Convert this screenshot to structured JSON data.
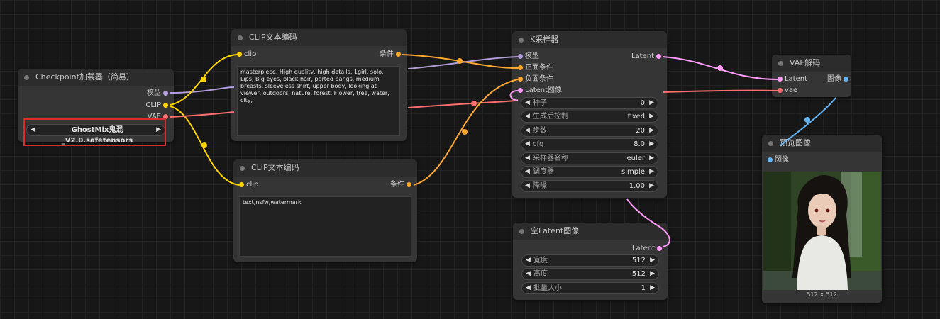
{
  "colors": {
    "model": "#b39ddb",
    "clip": "#ffd500",
    "vae": "#ff6e6e",
    "conditioning": "#ffa931",
    "latent": "#ff9cf9",
    "image": "#64b5f6"
  },
  "checkpoint": {
    "title": "Checkpoint加载器（简易）",
    "out_model": "模型",
    "out_clip": "CLIP",
    "out_vae": "VAE",
    "ckpt_name": "GhostMix鬼混_V2.0.safetensors"
  },
  "clip_pos": {
    "title": "CLIP文本编码",
    "in_clip": "clip",
    "out_cond": "条件",
    "text": "masterpiece, High quality, high details, 1girl, solo, Lips, Big eyes, black hair, parted bangs, medium breasts, sleeveless shirt, upper body, looking at viewer, outdoors, nature, forest, Flower, tree, water, city,"
  },
  "clip_neg": {
    "title": "CLIP文本编码",
    "in_clip": "clip",
    "out_cond": "条件",
    "text": "text,nsfw,watermark"
  },
  "ksampler": {
    "title": "K采样器",
    "in_model": "模型",
    "in_pos": "正面条件",
    "in_neg": "负面条件",
    "in_latent": "Latent图像",
    "out_latent": "Latent",
    "widgets": [
      {
        "label": "种子",
        "value": "0"
      },
      {
        "label": "生成后控制",
        "value": "fixed"
      },
      {
        "label": "步数",
        "value": "20"
      },
      {
        "label": "cfg",
        "value": "8.0"
      },
      {
        "label": "采样器名称",
        "value": "euler"
      },
      {
        "label": "调度器",
        "value": "simple"
      },
      {
        "label": "降噪",
        "value": "1.00"
      }
    ]
  },
  "empty_latent": {
    "title": "空Latent图像",
    "out_latent": "Latent",
    "widgets": [
      {
        "label": "宽度",
        "value": "512"
      },
      {
        "label": "高度",
        "value": "512"
      },
      {
        "label": "批量大小",
        "value": "1"
      }
    ]
  },
  "vae_decode": {
    "title": "VAE解码",
    "in_latent": "Latent",
    "in_vae": "vae",
    "out_image": "图像"
  },
  "preview": {
    "title": "预览图像",
    "in_image": "图像",
    "caption": "512 × 512"
  }
}
